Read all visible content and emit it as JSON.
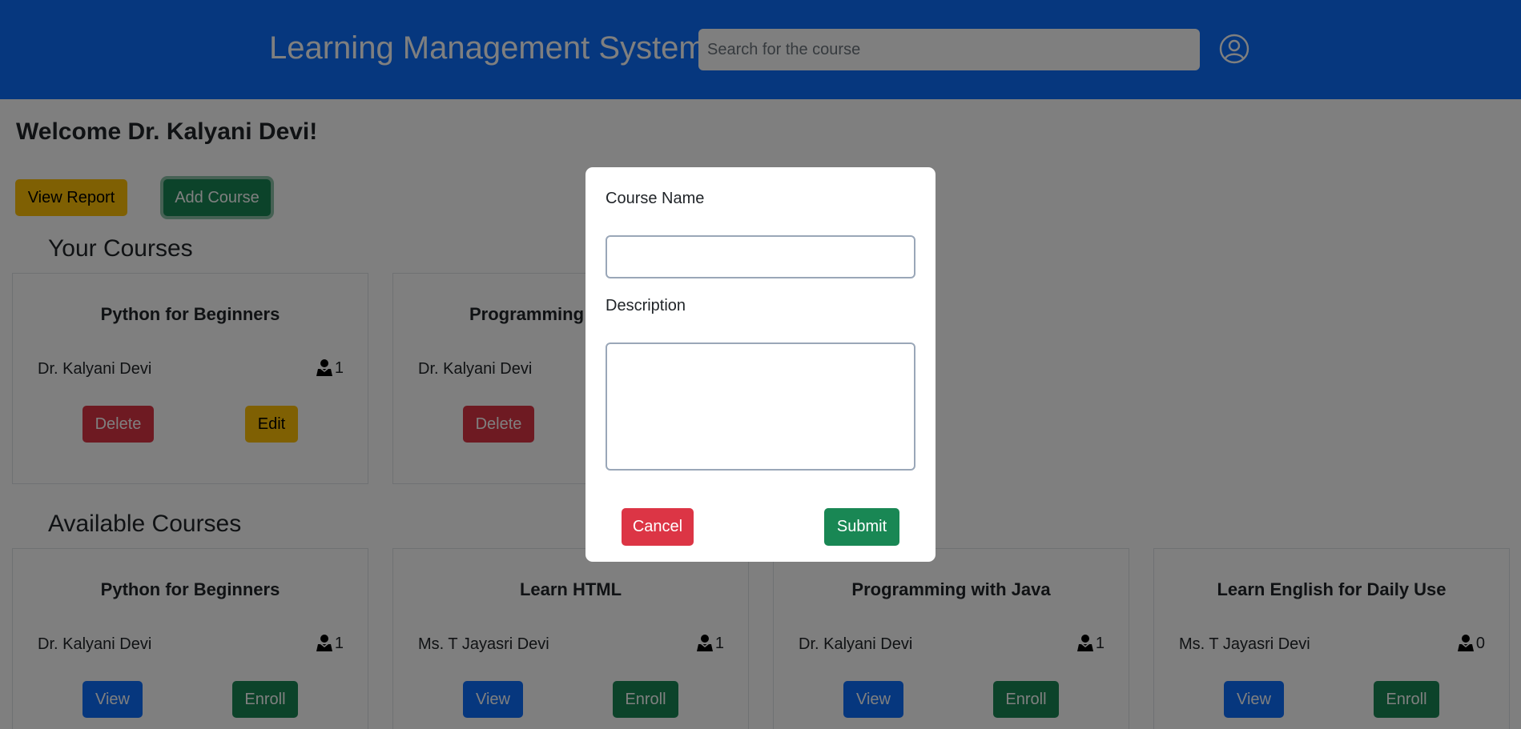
{
  "header": {
    "title": "Learning Management System",
    "search_placeholder": "Search for the course",
    "user_icon": "user-circle-icon"
  },
  "welcome": "Welcome Dr. Kalyani Devi!",
  "actions": {
    "view_report": "View Report",
    "add_course": "Add Course"
  },
  "your_courses": {
    "title": "Your Courses",
    "items": [
      {
        "title": "Python for Beginners",
        "instructor": "Dr. Kalyani Devi",
        "count": "1",
        "delete": "Delete",
        "edit": "Edit"
      },
      {
        "title": "Programming",
        "instructor": "Dr. Kalyani Devi",
        "delete": "Delete"
      }
    ]
  },
  "available_courses": {
    "title": "Available Courses",
    "items": [
      {
        "title": "Python for Beginners",
        "instructor": "Dr. Kalyani Devi",
        "count": "1",
        "view": "View",
        "enroll": "Enroll"
      },
      {
        "title": "Learn HTML",
        "instructor": "Ms. T Jayasri Devi",
        "count": "1",
        "view": "View",
        "enroll": "Enroll"
      },
      {
        "title": "Programming with Java",
        "instructor": "Dr. Kalyani Devi",
        "count": "1",
        "view": "View",
        "enroll": "Enroll"
      },
      {
        "title": "Learn English for Daily Use",
        "instructor": "Ms. T Jayasri Devi",
        "count": "0",
        "view": "View",
        "enroll": "Enroll"
      }
    ]
  },
  "modal": {
    "course_name_label": "Course Name",
    "course_name_value": "",
    "description_label": "Description",
    "description_value": "",
    "cancel": "Cancel",
    "submit": "Submit"
  },
  "colors": {
    "primary": "#0d6efd",
    "success": "#198754",
    "danger": "#dc3545",
    "warning": "#ffc107",
    "overlay": "rgba(0,0,0,0.5)"
  }
}
